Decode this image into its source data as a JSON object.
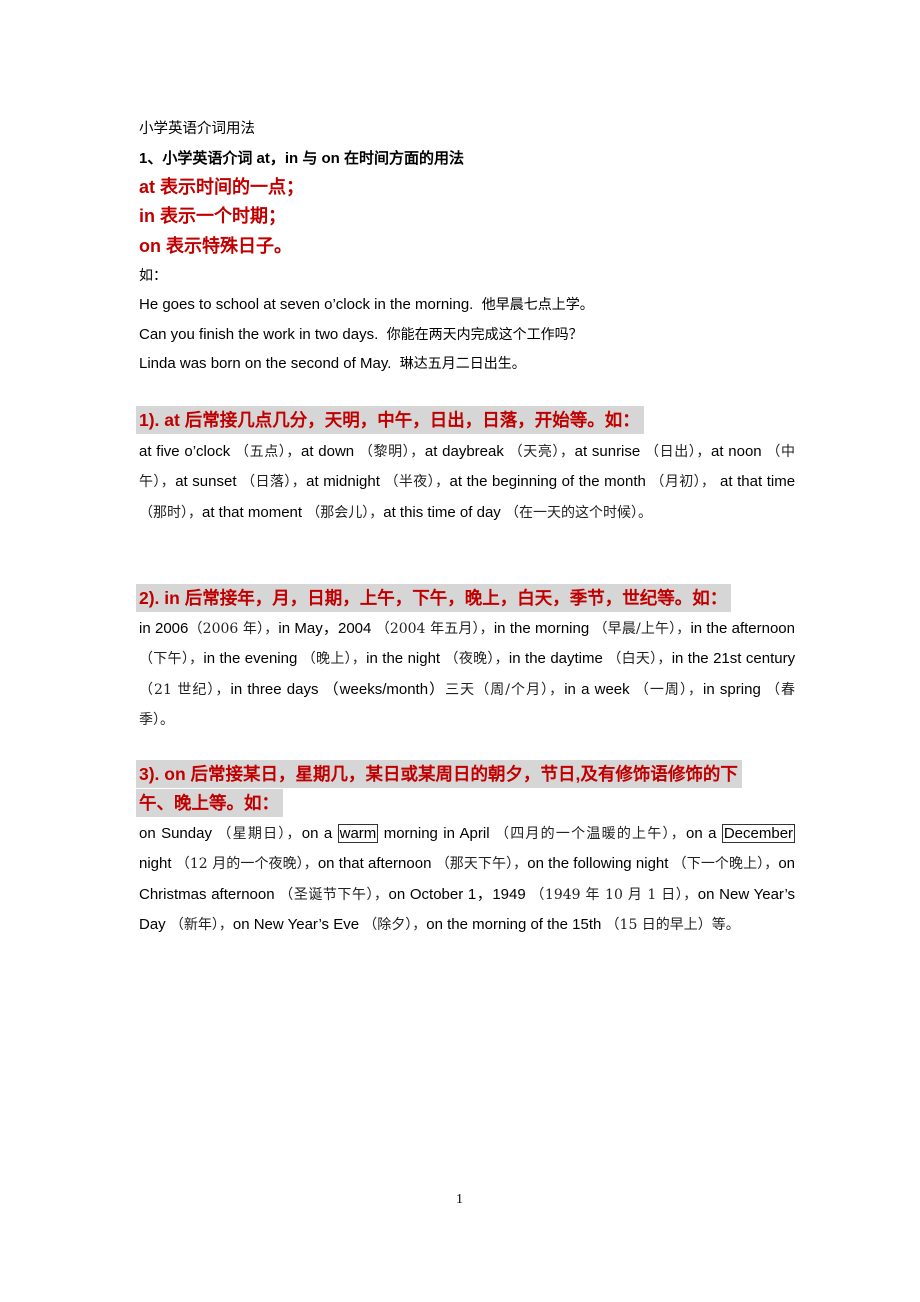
{
  "doc": {
    "title": "小学英语介词用法",
    "section1": "1、小学英语介词 at，in 与 on 在时间方面的用法",
    "rules": [
      "at 表示时间的一点；",
      "in 表示一个时期；",
      "on 表示特殊日子。"
    ],
    "example_label": "如：",
    "examples": [
      {
        "en": "He goes to school at seven o’clock in the morning.",
        "cn": "他早晨七点上学。"
      },
      {
        "en": "Can you finish the work in two days.",
        "cn": "你能在两天内完成这个工作吗？"
      },
      {
        "en": "Linda was born on the second of May.",
        "cn": "琳达五月二日出生。"
      }
    ],
    "headings": [
      "1). at 后常接几点几分，天明，中午，日出，日落，开始等。如：",
      "2). in 后常接年，月，日期，上午，下午，晚上，白天，季节，世纪等。如：",
      "3). on 后常接某日，星期几，某日或某周日的朝夕，节日,及有修饰语修饰的下",
      "午、晚上等。如："
    ],
    "at_examples": [
      {
        "en": "at five o’clock",
        "cn": "（五点），"
      },
      {
        "en": "at down",
        "cn": "（黎明），"
      },
      {
        "en": "at daybreak",
        "cn": "（天亮），"
      },
      {
        "en": "at sunrise",
        "cn": "（日出），"
      },
      {
        "en": "at noon",
        "cn": "（中午），"
      },
      {
        "en": "at sunset",
        "cn": "（日落），"
      },
      {
        "en": "at midnight",
        "cn": "（半夜），"
      },
      {
        "en": "at the beginning of the month",
        "cn": "（月初），"
      },
      {
        "en": "at that time",
        "cn": "（那时），"
      },
      {
        "en": "at that moment",
        "cn": "（那会儿），"
      },
      {
        "en": "at this time of day",
        "cn": "（在一天的这个时候）。"
      }
    ],
    "in_examples": [
      {
        "en": "in 2006",
        "cn": "（2006 年），"
      },
      {
        "en": "in May，2004",
        "cn": "（2004 年五月），"
      },
      {
        "en": "in the morning",
        "cn": "（早晨/上午），"
      },
      {
        "en": "in the afternoon",
        "cn": "（下午），"
      },
      {
        "en": "in the evening",
        "cn": "（晚上），"
      },
      {
        "en": "in the night",
        "cn": "（夜晚），"
      },
      {
        "en": "in the daytime",
        "cn": "（白天），"
      },
      {
        "en": "in the 21st century",
        "cn": "（21 世纪），"
      },
      {
        "en": "in three days （weeks/month）",
        "cn": "三天（周/个月），"
      },
      {
        "en": "in a week",
        "cn": "（一周），"
      },
      {
        "en": "in spring",
        "cn": "（春季）。"
      }
    ],
    "on_examples": {
      "e1_en": "on Sunday",
      "e1_cn": "（星期日），",
      "e2_pre": "on a",
      "e2_boxed": "warm",
      "e2_post": "morning in April",
      "e2_cn": "（四月的一个温暖的上午），",
      "e3_pre": "on a",
      "e3_boxed": "December",
      "e3_post": "night",
      "e3_cn": "（12 月的一个夜晚），",
      "e4_en": "on that afternoon",
      "e4_cn": "（那天下午），",
      "e5_en": "on the following night",
      "e5_cn": "（下一个晚上），",
      "e6_en": "on Christmas afternoon",
      "e6_cn": "（圣诞节下午），",
      "e7_en": "on October 1，1949",
      "e7_cn": "（1949 年 10 月 1 日），",
      "e8_en": "on New Year’s Day",
      "e8_cn": "（新年），",
      "e9_en": "on New Year’s Eve",
      "e9_cn": "（除夕），",
      "e10_en": "on the morning of the 15th",
      "e10_cn": "（15 日的早上）等。"
    },
    "page_number": "1"
  }
}
